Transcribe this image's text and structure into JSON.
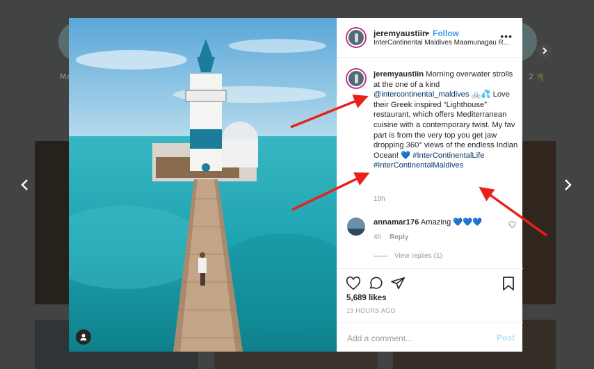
{
  "stories": {
    "left_label": "Ma",
    "right_label": "2 🌴"
  },
  "post": {
    "username": "jeremyaustiin",
    "separator": "•",
    "follow_label": "Follow",
    "location": "InterContinental Maldives Maamunagau R...",
    "more_label": "•••",
    "caption": {
      "username": "jeremyaustiin",
      "text_1": " Morning overwater strolls at the one of a kind ",
      "mention": "@intercontinental_maldives",
      "text_2": " 🚲💦 Love their Greek inspired “Lighthouse” restaurant, which offers Mediterranean cuisine with a contemporary twist. My fav part is from the very top you get jaw dropping 360° views of the endless Indian Ocean! 💙 ",
      "hashtag_1": "#InterContinentalLife",
      "hashtag_2": "#InterContinentalMaldives"
    },
    "caption_time": "19h",
    "comment": {
      "username": "annamar176",
      "text": " Amazing 💙💙💙",
      "time": "4h",
      "reply_label": "Reply"
    },
    "view_replies": "View replies (1)",
    "likes": "5,689 likes",
    "posted_ago": "19 HOURS AGO",
    "comment_placeholder": "Add a comment...",
    "post_label": "Post"
  },
  "colors": {
    "accent": "#3897f0",
    "link": "#003569",
    "annotation_arrow": "#e8221b"
  }
}
